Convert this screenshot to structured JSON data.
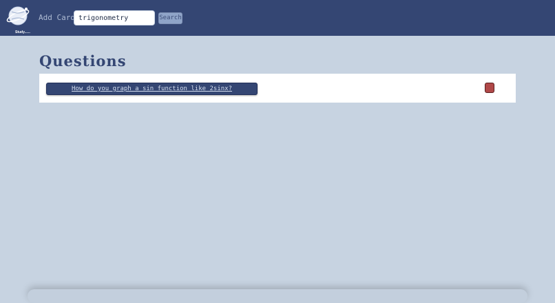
{
  "header": {
    "logo_text": "Study......",
    "add_cards_label": "Add Cards",
    "search": {
      "value": "trigonometry"
    },
    "search_button_label": "Search"
  },
  "main": {
    "title": "Questions",
    "questions": [
      {
        "text": "How do you graph a sin function like 2sinx?"
      }
    ]
  },
  "colors": {
    "header_bg": "#344673",
    "page_bg": "#c7d3e1",
    "delete_button": "#b04848"
  }
}
